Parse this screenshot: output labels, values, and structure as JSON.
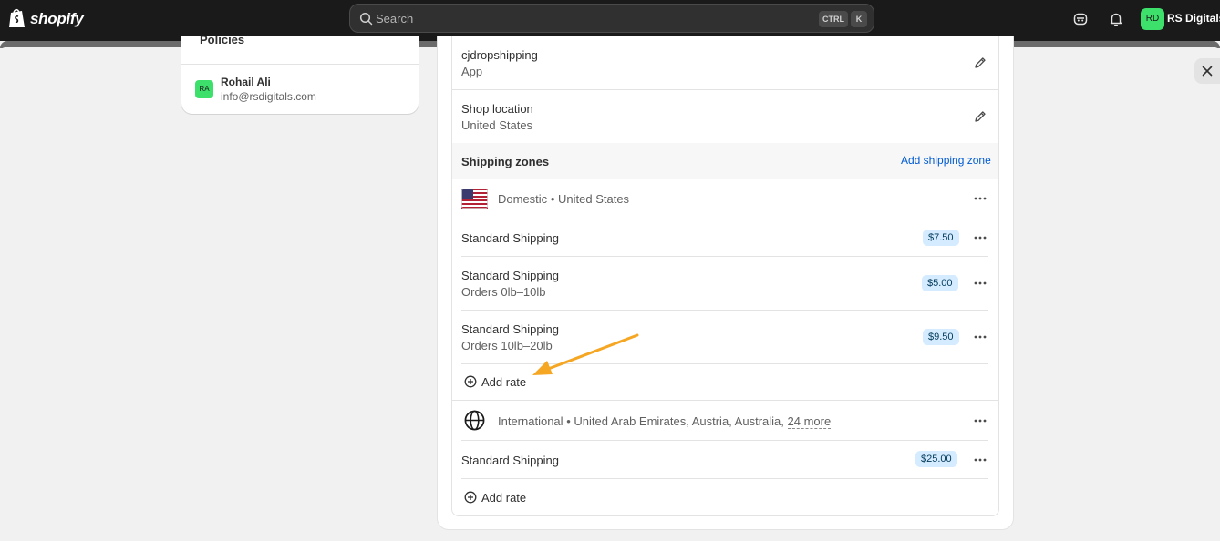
{
  "topbar": {
    "brand": "shopify",
    "search_placeholder": "Search",
    "shortcut_ctrl": "CTRL",
    "shortcut_key": "K",
    "avatar_initials": "RD",
    "store_name": "RS Digitals"
  },
  "sidebar": {
    "cut_item_label": "Policies",
    "user_initials": "RA",
    "user_name": "Rohail Ali",
    "user_email": "info@rsdigitals.com"
  },
  "origins": [
    {
      "title": "cjdropshipping",
      "subtitle": "App"
    },
    {
      "title": "Shop location",
      "subtitle": "United States"
    }
  ],
  "zones": {
    "heading": "Shipping zones",
    "add_zone_label": "Add shipping zone",
    "domestic": {
      "name": "Domestic",
      "separator": "•",
      "countries": "United States",
      "rates": [
        {
          "name": "Standard Shipping",
          "condition": "",
          "price": "$7.50"
        },
        {
          "name": "Standard Shipping",
          "condition": "Orders 0lb–10lb",
          "price": "$5.00"
        },
        {
          "name": "Standard Shipping",
          "condition": "Orders 10lb–20lb",
          "price": "$9.50"
        }
      ],
      "add_rate_label": "Add rate"
    },
    "international": {
      "name": "International",
      "separator": "•",
      "countries": "United Arab Emirates, Austria, Australia,",
      "more_label": "24 more",
      "rates": [
        {
          "name": "Standard Shipping",
          "price": "$25.00"
        }
      ],
      "add_rate_label": "Add rate"
    }
  },
  "colors": {
    "accent_link": "#005bd3",
    "price_badge_bg": "#d5ebff",
    "avatar_green": "#3ee06c",
    "annotation_arrow": "#f5a623"
  }
}
